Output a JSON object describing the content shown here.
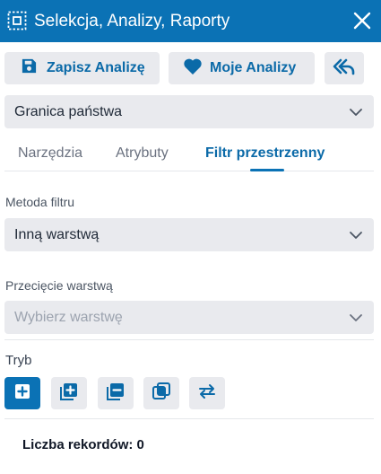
{
  "header": {
    "title": "Selekcja, Analizy, Raporty",
    "icon": "selection-icon",
    "close_icon": "close-icon",
    "background_color": "#0b72b5"
  },
  "toolbar": {
    "save_label": "Zapisz Analizę",
    "save_icon": "floppy-disk-icon",
    "favorites_label": "Moje Analizy",
    "favorites_icon": "heart-icon",
    "back_icon": "reply-all-icon"
  },
  "layer_select": {
    "value": "Granica państwa"
  },
  "tabs": [
    {
      "label": "Narzędzia",
      "active": false
    },
    {
      "label": "Atrybuty",
      "active": false
    },
    {
      "label": "Filtr przestrzenny",
      "active": true
    }
  ],
  "filter_method": {
    "label": "Metoda filtru",
    "value": "Inną warstwą"
  },
  "layer_intersection": {
    "label": "Przecięcie warstwą",
    "placeholder": "Wybierz warstwę"
  },
  "mode": {
    "label": "Tryb",
    "buttons": [
      {
        "icon": "new-selection-icon",
        "active": true
      },
      {
        "icon": "add-to-selection-icon",
        "active": false
      },
      {
        "icon": "remove-from-selection-icon",
        "active": false
      },
      {
        "icon": "intersect-selection-icon",
        "active": false
      },
      {
        "icon": "swap-selection-icon",
        "active": false
      }
    ]
  },
  "records": {
    "label": "Liczba rekordów:",
    "count": "0"
  },
  "colors": {
    "accent": "#0b72b5",
    "button_bg": "#e9eaee",
    "accent_text": "#0b6aa8"
  }
}
